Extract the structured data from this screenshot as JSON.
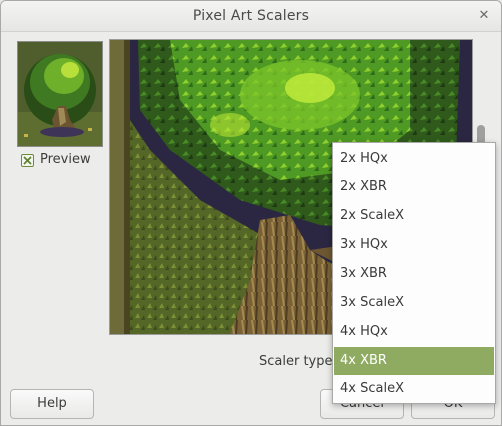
{
  "window": {
    "title": "Pixel Art Scalers"
  },
  "preview": {
    "label": "Preview",
    "checked": true
  },
  "scaler": {
    "label": "Scaler type:",
    "options": [
      "2x HQx",
      "2x XBR",
      "2x ScaleX",
      "3x HQx",
      "3x XBR",
      "3x ScaleX",
      "4x HQx",
      "4x XBR",
      "4x ScaleX"
    ],
    "selected": "4x XBR"
  },
  "buttons": {
    "help": "Help",
    "cancel": "Cancel",
    "ok": "OK"
  },
  "colors": {
    "accent": "#8fab62",
    "selected_text": "#ffffff"
  }
}
